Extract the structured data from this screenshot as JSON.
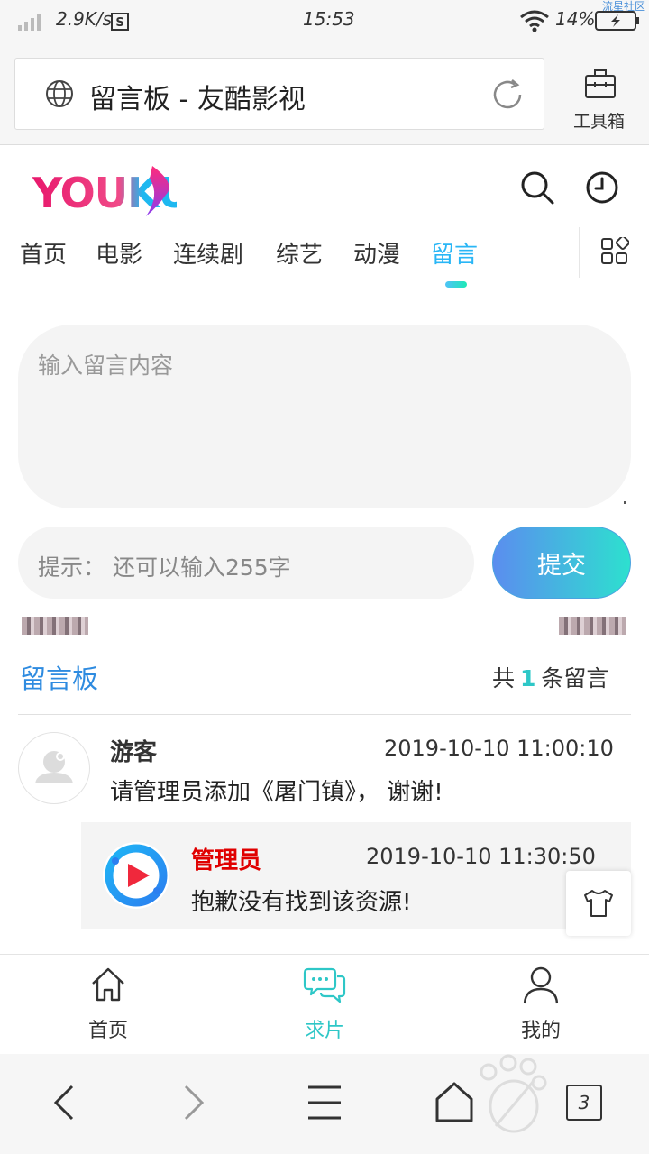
{
  "status": {
    "speed": "2.9K/s",
    "time": "15:53",
    "battery": "14%",
    "corner_text": "流星社区"
  },
  "browser": {
    "page_title": "留言板 - 友酷影视",
    "toolbox_label": "工具箱",
    "tab_count": "3"
  },
  "site": {
    "logo_text": "YOUKU",
    "nav": [
      "首页",
      "电影",
      "连续剧",
      "综艺",
      "动漫",
      "留言"
    ],
    "active_nav": "留言"
  },
  "form": {
    "placeholder": "输入留言内容",
    "hint": "提示：  还可以输入255字",
    "submit_label": "提交"
  },
  "board": {
    "title": "留言板",
    "count_prefix": "共",
    "count": "1",
    "count_suffix": "条留言"
  },
  "messages": [
    {
      "user": "游客",
      "time": "2019-10-10 11:00:10",
      "text": "请管理员添加《屠门镇》， 谢谢!",
      "reply": {
        "user": "管理员",
        "time": "2019-10-10 11:30:50",
        "text": "抱歉没有找到该资源!"
      }
    }
  ],
  "tabbar": [
    {
      "label": "首页",
      "icon": "home-icon"
    },
    {
      "label": "求片",
      "icon": "chat-bubbles-icon"
    },
    {
      "label": "我的",
      "icon": "user-icon"
    }
  ],
  "colors": {
    "accent": "#2ec7c7",
    "link_blue": "#2e8be0",
    "admin_red": "#e00000",
    "logo_pink": "#e8186c",
    "logo_blue": "#1eb8f0"
  }
}
